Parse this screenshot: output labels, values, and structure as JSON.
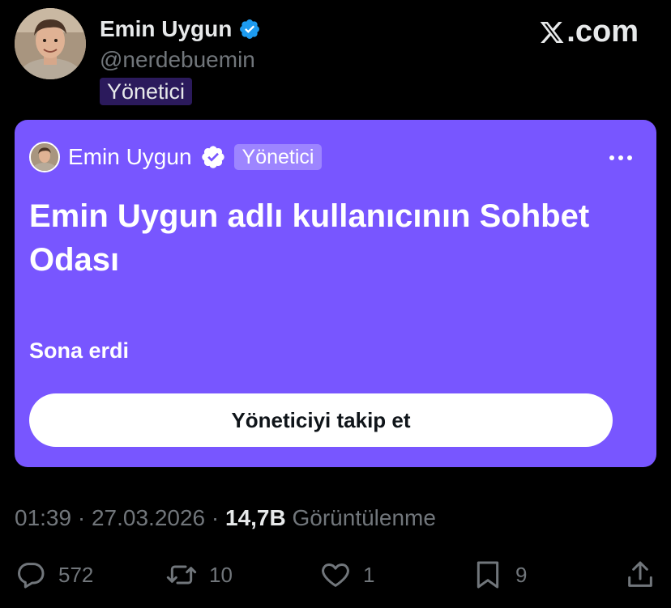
{
  "author": {
    "name": "Emin Uygun",
    "handle": "@nerdebuemin",
    "badge": "Yönetici"
  },
  "brand": ".com",
  "card": {
    "host_name": "Emin Uygun",
    "host_badge": "Yönetici",
    "title": "Emin Uygun adlı kullanıcının Sohbet Odası",
    "status": "Sona erdi",
    "follow_button": "Yöneticiyi takip et",
    "background_color": "#7856ff"
  },
  "meta": {
    "time": "01:39",
    "date": "27.03.2026",
    "views_count": "14,7B",
    "views_label": "Görüntülenme"
  },
  "actions": {
    "replies": "572",
    "reposts": "10",
    "likes": "1",
    "bookmarks": "9"
  },
  "colors": {
    "verified": "#1d9bf0",
    "muted": "#71767b",
    "badge_bg": "#2b1a5c"
  }
}
